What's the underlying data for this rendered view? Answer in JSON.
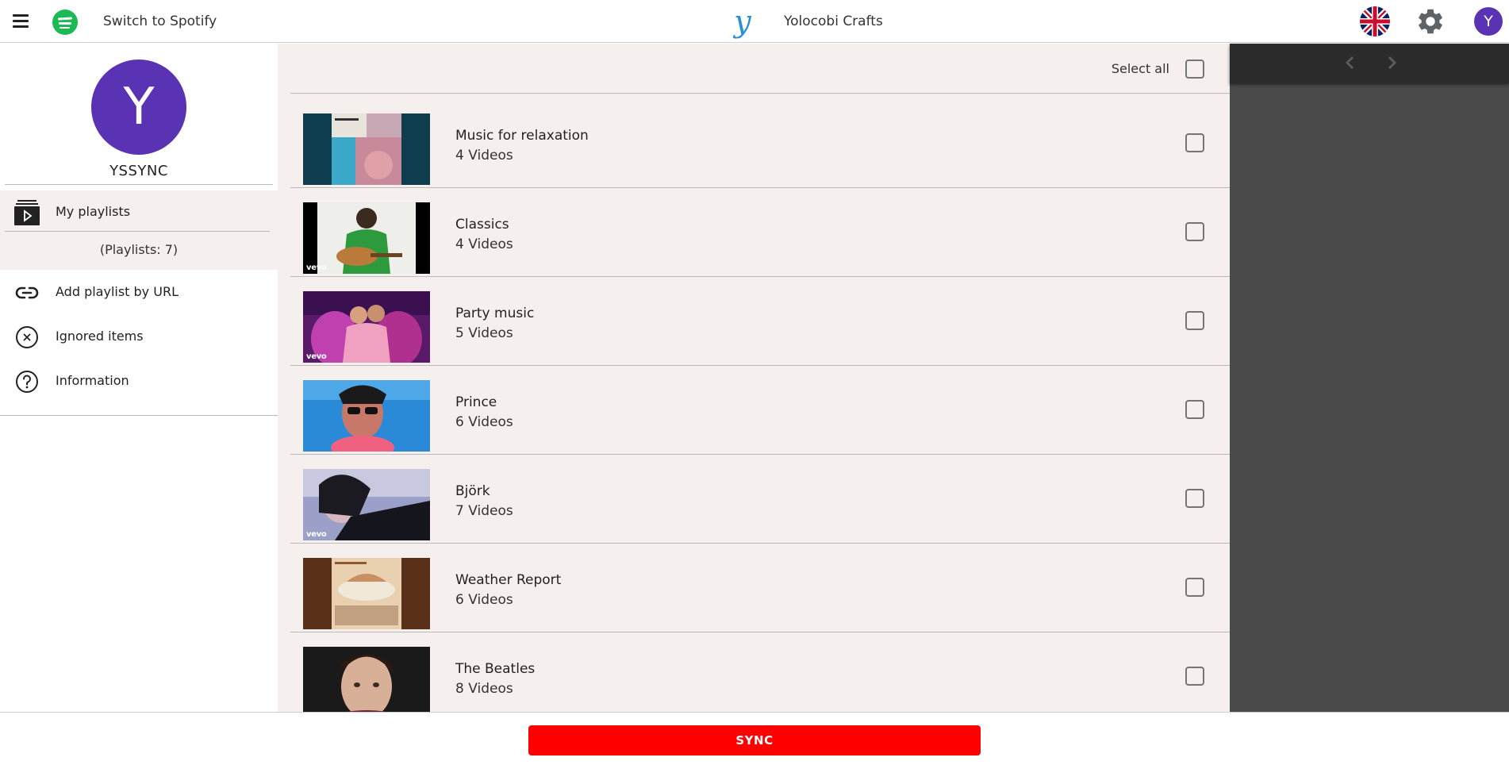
{
  "header": {
    "switch_label": "Switch to Spotify",
    "brand_logo": "y",
    "brand_name": "Yolocobi Crafts",
    "avatar_letter": "Y"
  },
  "sidebar": {
    "avatar_letter": "Y",
    "username": "YSSYNC",
    "items": [
      {
        "label": "My playlists",
        "icon": "playlist-icon"
      },
      {
        "label": "Add playlist by URL",
        "icon": "link-icon"
      },
      {
        "label": "Ignored items",
        "icon": "close-circle-icon"
      },
      {
        "label": "Information",
        "icon": "help-circle-icon"
      }
    ],
    "playlist_count": "(Playlists: 7)"
  },
  "main": {
    "select_all_label": "Select all",
    "playlists": [
      {
        "title": "Music for relaxation",
        "count": "4 Videos"
      },
      {
        "title": "Classics",
        "count": "4 Videos"
      },
      {
        "title": "Party music",
        "count": "5 Videos"
      },
      {
        "title": "Prince",
        "count": "6 Videos"
      },
      {
        "title": "Björk",
        "count": "7 Videos"
      },
      {
        "title": "Weather Report",
        "count": "6 Videos"
      },
      {
        "title": "The Beatles",
        "count": "8 Videos"
      }
    ],
    "vevo_label": "vevo"
  },
  "footer": {
    "sync_label": "SYNC"
  },
  "colors": {
    "accent_purple": "#5a32b4",
    "sync_red": "#ff0000",
    "spotify_green": "#1db954",
    "list_background": "#f5efee",
    "right_panel": "#4b4b4b"
  }
}
